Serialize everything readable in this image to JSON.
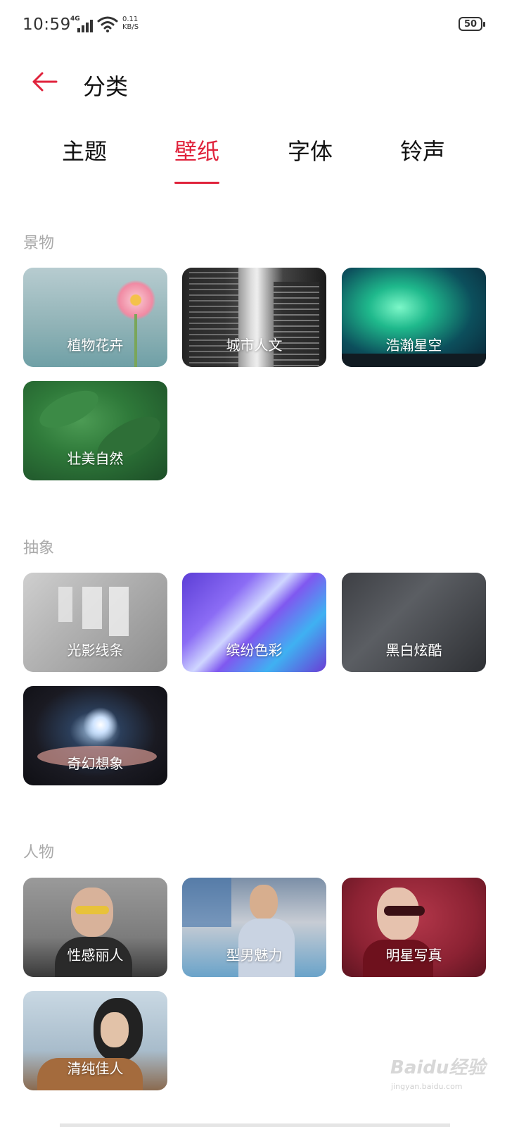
{
  "status_bar": {
    "time": "10:59",
    "network_type": "4G",
    "speed_value": "0.11",
    "speed_unit": "KB/S",
    "battery": "50",
    "icons": [
      "signal-icon",
      "wifi-icon",
      "battery-icon"
    ]
  },
  "header": {
    "back_icon": "back-arrow-icon",
    "title": "分类"
  },
  "tabs": [
    {
      "label": "主题",
      "active": false
    },
    {
      "label": "壁纸",
      "active": true
    },
    {
      "label": "字体",
      "active": false
    },
    {
      "label": "铃声",
      "active": false
    }
  ],
  "colors": {
    "accent": "#e0233c",
    "section_title": "#aaaaaa"
  },
  "sections": [
    {
      "title": "景物",
      "items": [
        "植物花卉",
        "城市人文",
        "浩瀚星空",
        "壮美自然"
      ]
    },
    {
      "title": "抽象",
      "items": [
        "光影线条",
        "缤纷色彩",
        "黑白炫酷",
        "奇幻想象"
      ]
    },
    {
      "title": "人物",
      "items": [
        "性感丽人",
        "型男魅力",
        "明星写真",
        "清纯佳人"
      ]
    }
  ],
  "watermark": {
    "brand": "Baidu经验",
    "url": "jingyan.baidu.com"
  }
}
